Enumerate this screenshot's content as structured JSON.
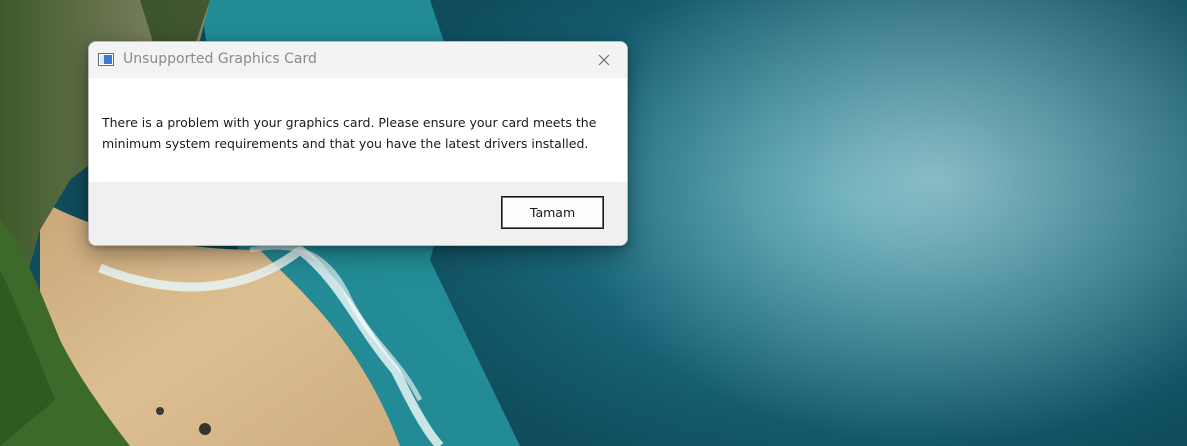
{
  "desktop": {
    "wallpaper": "coastal-beach-ocean-aerial",
    "colors": {
      "ocean": "#1d7285",
      "sand": "#d9b98a",
      "foliage": "#3d6a2a",
      "surf": "#e8f4f4"
    }
  },
  "dialog": {
    "title": "Unsupported Graphics Card",
    "icon": "window-app-icon",
    "close_icon": "close-icon",
    "message": "There is a problem with your graphics card. Please ensure your card meets the minimum system requirements and that you have the latest drivers installed.",
    "ok_label": "Tamam",
    "colors": {
      "titlebar": "#f3f3f3",
      "footer": "#f0f0f0",
      "title_text": "#8a8a8a"
    }
  }
}
